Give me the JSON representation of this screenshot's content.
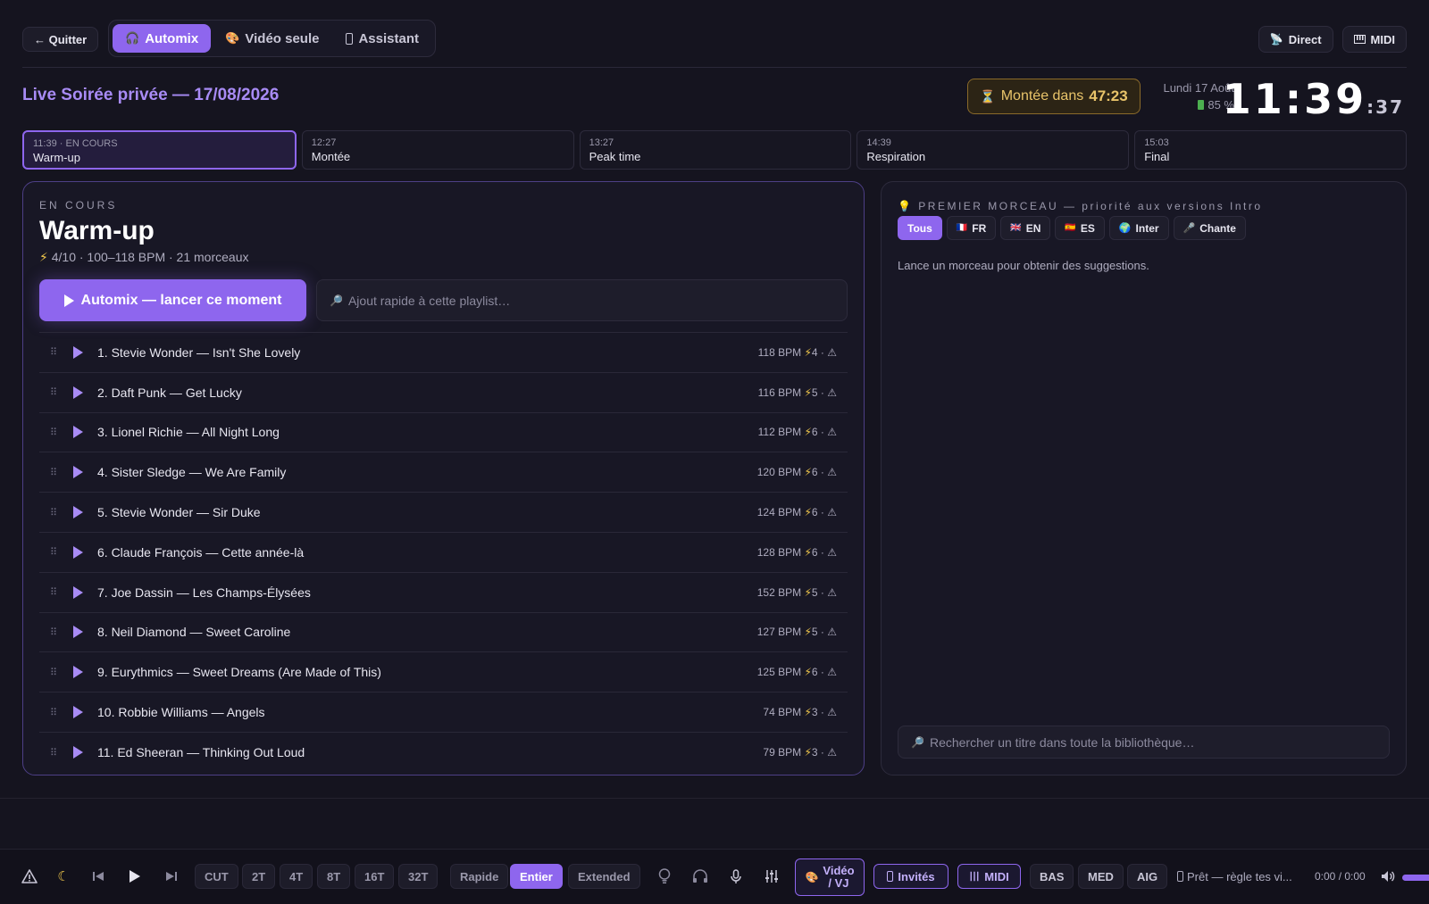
{
  "topbar": {
    "quit_label": "← Quitter",
    "tabs": [
      {
        "icon": "headphones-icon",
        "glyph": "🎧",
        "label": "Automix",
        "active": true
      },
      {
        "icon": "palette-icon",
        "glyph": "🎨",
        "label": "Vidéo seule",
        "active": false
      },
      {
        "icon": "remote-icon",
        "glyph": "▯",
        "label": "Assistant",
        "active": false
      }
    ],
    "direct_label": "Direct",
    "midi_label": "MIDI"
  },
  "header": {
    "event_title": "Live Soirée privée — 17/08/2026",
    "countdown_prefix": "Montée dans",
    "countdown_value": "47:23",
    "date": "Lundi 17 Août",
    "battery": "85 %",
    "clock_hm": "11:39",
    "clock_s": ":37"
  },
  "timeline": [
    {
      "time": "11:39 · EN COURS",
      "name": "Warm-up",
      "current": true
    },
    {
      "time": "12:27",
      "name": "Montée",
      "current": false
    },
    {
      "time": "13:27",
      "name": "Peak time",
      "current": false
    },
    {
      "time": "14:39",
      "name": "Respiration",
      "current": false
    },
    {
      "time": "15:03",
      "name": "Final",
      "current": false
    }
  ],
  "moment": {
    "label": "EN COURS",
    "title": "Warm-up",
    "meta": "4/10 · 100–118 BPM · 21 morceaux",
    "launch_label": "Automix — lancer ce moment",
    "quick_add_placeholder": "Ajout rapide à cette playlist…"
  },
  "tracks": [
    {
      "title": "1. Stevie Wonder — Isn't She Lovely",
      "bpm": "118 BPM",
      "energy": "4"
    },
    {
      "title": "2. Daft Punk — Get Lucky",
      "bpm": "116 BPM",
      "energy": "5"
    },
    {
      "title": "3. Lionel Richie — All Night Long",
      "bpm": "112 BPM",
      "energy": "6"
    },
    {
      "title": "4. Sister Sledge — We Are Family",
      "bpm": "120 BPM",
      "energy": "6"
    },
    {
      "title": "5. Stevie Wonder — Sir Duke",
      "bpm": "124 BPM",
      "energy": "6"
    },
    {
      "title": "6. Claude François — Cette année-là",
      "bpm": "128 BPM",
      "energy": "6"
    },
    {
      "title": "7. Joe Dassin — Les Champs-Élysées",
      "bpm": "152 BPM",
      "energy": "5"
    },
    {
      "title": "8. Neil Diamond — Sweet Caroline",
      "bpm": "127 BPM",
      "energy": "5"
    },
    {
      "title": "9. Eurythmics — Sweet Dreams (Are Made of This)",
      "bpm": "125 BPM",
      "energy": "6"
    },
    {
      "title": "10. Robbie Williams — Angels",
      "bpm": "74 BPM",
      "energy": "3"
    },
    {
      "title": "11. Ed Sheeran — Thinking Out Loud",
      "bpm": "79 BPM",
      "energy": "3"
    }
  ],
  "suggestions": {
    "heading": "PREMIER MORCEAU — priorité aux versions Intro",
    "chips": [
      {
        "label": "Tous",
        "glyph": "",
        "active": true
      },
      {
        "label": "FR",
        "glyph": "🇫🇷",
        "active": false
      },
      {
        "label": "EN",
        "glyph": "🇬🇧",
        "active": false
      },
      {
        "label": "ES",
        "glyph": "🇪🇸",
        "active": false
      },
      {
        "label": "Inter",
        "glyph": "🌍",
        "active": false
      },
      {
        "label": "Chante",
        "glyph": "🎤",
        "active": false
      }
    ],
    "empty_text": "Lance un morceau pour obtenir des suggestions.",
    "search_placeholder": "Rechercher un titre dans toute la bibliothèque…"
  },
  "bottombar": {
    "cut_buttons": [
      "CUT",
      "2T",
      "4T",
      "8T",
      "16T",
      "32T"
    ],
    "mix_modes": [
      {
        "label": "Rapide",
        "active": false
      },
      {
        "label": "Entier",
        "active": true
      },
      {
        "label": "Extended",
        "active": false
      }
    ],
    "video_label_1": "Vidéo",
    "video_label_2": "/ VJ",
    "guests_label": "Invités",
    "midi_label": "MIDI",
    "eq_buttons": [
      "BAS",
      "MED",
      "AIG"
    ],
    "status": "Prêt — règle tes vi...",
    "time": "0:00 / 0:00"
  },
  "colors": {
    "accent": "#8e66ee",
    "accent_text": "#a88bf5",
    "background": "#15141f",
    "warning": "#e9c46a",
    "energy": "#f2c94c"
  }
}
